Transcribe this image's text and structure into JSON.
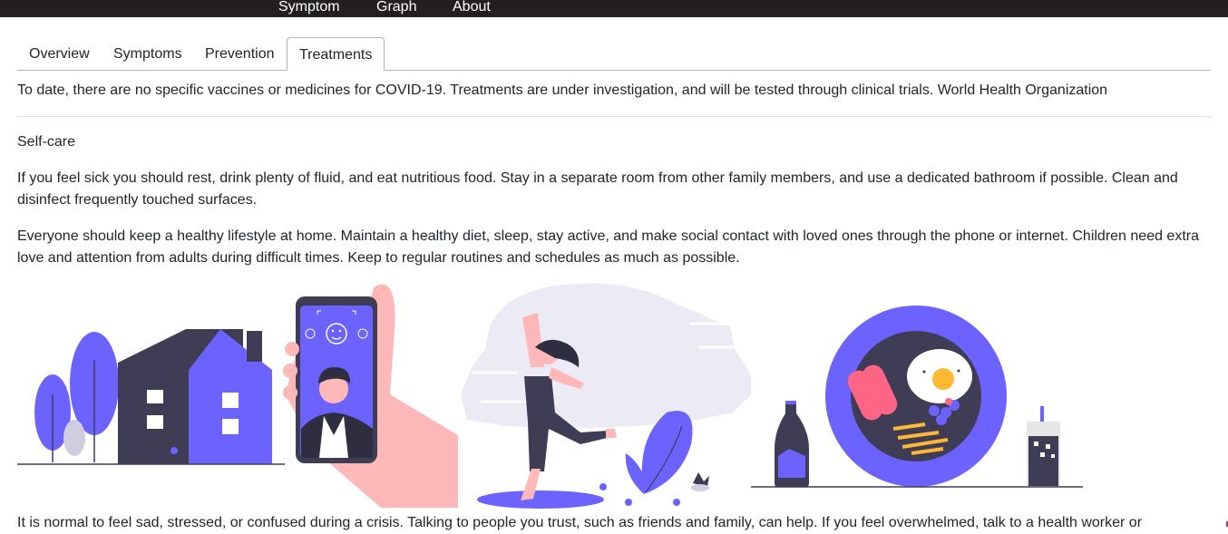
{
  "nav": {
    "items": [
      "Symptom",
      "Graph",
      "About"
    ]
  },
  "tabs": [
    {
      "label": "Overview",
      "active": false
    },
    {
      "label": "Symptoms",
      "active": false
    },
    {
      "label": "Prevention",
      "active": false
    },
    {
      "label": "Treatments",
      "active": true
    }
  ],
  "content": {
    "intro": "To date, there are no specific vaccines or medicines for COVID-19. Treatments are under investigation, and will be tested through clinical trials. World Health Organization",
    "heading": "Self-care",
    "para1": "If you feel sick you should rest, drink plenty of fluid, and eat nutritious food. Stay in a separate room from other family members, and use a dedicated bathroom if possible. Clean and disinfect frequently touched surfaces.",
    "para2": "Everyone should keep a healthy lifestyle at home. Maintain a healthy diet, sleep, stay active, and make social contact with loved ones through the phone or internet. Children need extra love and attention from adults during difficult times. Keep to regular routines and schedules as much as possible.",
    "para3": "It is normal to feel sad, stressed, or confused during a crisis. Talking to people you trust, such as friends and family, can help. If you feel overwhelmed, talk to a health worker or"
  },
  "colors": {
    "accent": "#6c63ff",
    "dark": "#3f3d56",
    "skin": "#ffb8b8",
    "navbar": "#231f20"
  },
  "illustrations": [
    "home-illustration",
    "video-call-illustration",
    "exercise-illustration",
    "healthy-meal-illustration"
  ]
}
